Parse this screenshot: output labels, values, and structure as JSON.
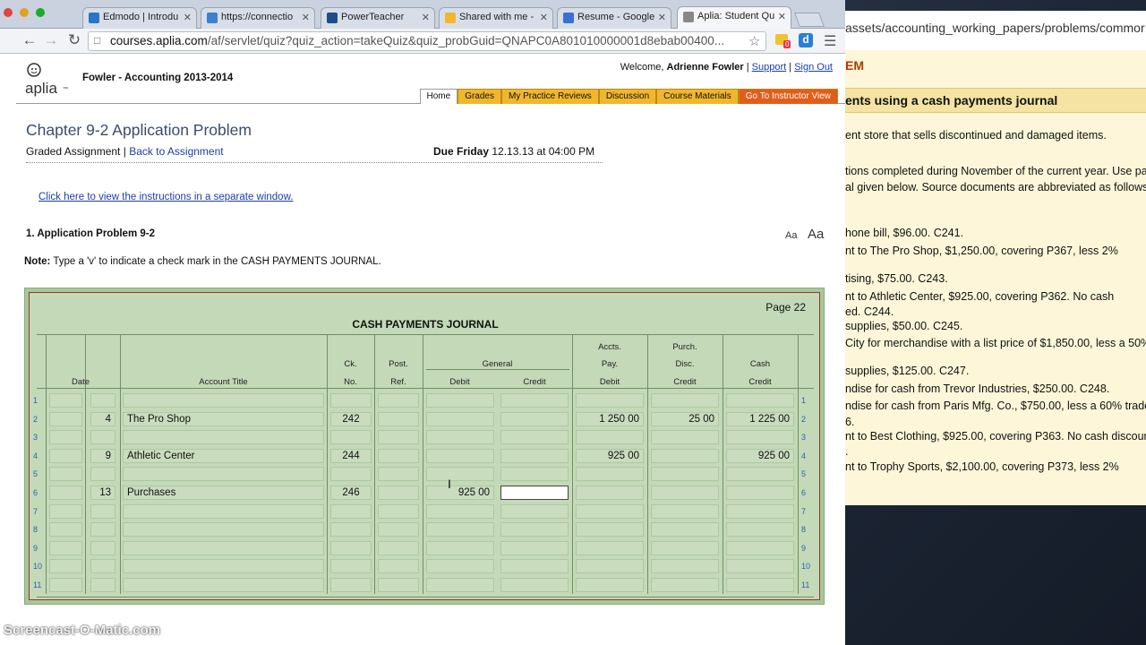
{
  "browser": {
    "tabs": [
      {
        "label": "Edmodo | Introdu",
        "icon_color": "#2b74c6"
      },
      {
        "label": "https://connectio",
        "icon_color": "#3f7fcf"
      },
      {
        "label": "PowerTeacher",
        "icon_color": "#1e4d8c"
      },
      {
        "label": "Shared with me -",
        "icon_color": "#f1b72c"
      },
      {
        "label": "Resume - Google",
        "icon_color": "#3b6fd6"
      },
      {
        "label": "Aplia: Student Qu",
        "icon_color": "#888888"
      }
    ],
    "url_host": "courses.aplia.com",
    "url_path": "/af/servlet/quiz?quiz_action=takeQuiz&quiz_probGuid=QNAPC0A801010000001d8ebab00400...",
    "ext_badge": "0"
  },
  "bg_window": {
    "url": "assets/accounting_working_papers/problems/commor",
    "heading_suffix": "EM",
    "subheading": "ents using a cash payments journal",
    "lines": [
      "ent store that sells discontinued and damaged items.",
      "tions completed during November of the current year. Use page",
      "al given below. Source documents are abbreviated as follows:",
      "hone bill, $96.00. C241.",
      "nt to The Pro Shop, $1,250.00, covering P367, less 2%",
      "tising, $75.00. C243.",
      "nt to Athletic Center, $925.00, covering P362. No cash",
      "ed. C244.",
      "supplies, $50.00. C245.",
      "City for merchandise with a list price of $1,850.00, less a 50%",
      "supplies, $125.00. C247.",
      "ndise for cash from Trevor Industries, $250.00. C248.",
      "ndise for cash from Paris Mfg. Co., $750.00, less a 60% trade",
      "6.",
      "nt to Best Clothing, $925.00, covering P363. No cash discount",
      ".",
      "nt to Trophy Sports, $2,100.00, covering P373, less 2%"
    ]
  },
  "aplia": {
    "logo_text": "aplia",
    "logo_tm": "™",
    "course": "Fowler - Accounting 2013-2014",
    "welcome_prefix": "Welcome,",
    "user_name": "Adrienne Fowler",
    "support": "Support",
    "sign_out": "Sign Out",
    "separator": "|",
    "nav": [
      "Home",
      "Grades",
      "My Practice Reviews",
      "Discussion",
      "Course Materials",
      "Go To Instructor View"
    ]
  },
  "page": {
    "title": "Chapter 9-2 Application Problem",
    "graded": "Graded Assignment",
    "sep": "|",
    "back": "Back to Assignment",
    "due_label": "Due Friday",
    "due_value": "12.13.13 at 04:00 PM",
    "instructions_link": "Click here to view the instructions in a separate window.",
    "problem": "1.  Application Problem 9-2",
    "font_small": "Aa",
    "font_large": "Aa",
    "note_label": "Note:",
    "note_text": " Type a 'v' to indicate a check mark in the CASH PAYMENTS JOURNAL."
  },
  "journal": {
    "page_label": "Page 22",
    "title": "CASH PAYMENTS JOURNAL",
    "headers": {
      "date": "Date",
      "account": "Account Title",
      "ck1": "Ck.",
      "ck2": "No.",
      "post1": "Post.",
      "post2": "Ref.",
      "general": "General",
      "gdebit": "Debit",
      "gcredit": "Credit",
      "ap1": "Accts.",
      "ap2": "Pay.",
      "ap3": "Debit",
      "pd1": "Purch.",
      "pd2": "Disc.",
      "pd3": "Credit",
      "cash1": "Cash",
      "cash2": "Credit"
    },
    "rows": [
      {
        "n": "1",
        "month": "",
        "day": "",
        "account": "",
        "ck": "",
        "post": "",
        "gdebit": "",
        "gcredit": "",
        "ap": "",
        "pd": "",
        "cash": ""
      },
      {
        "n": "2",
        "month": "",
        "day": "4",
        "account": "The Pro Shop",
        "ck": "242",
        "post": "",
        "gdebit": "",
        "gcredit": "",
        "ap": "1 250 00",
        "pd": "25 00",
        "cash": "1 225 00"
      },
      {
        "n": "3",
        "month": "",
        "day": "",
        "account": "",
        "ck": "",
        "post": "",
        "gdebit": "",
        "gcredit": "",
        "ap": "",
        "pd": "",
        "cash": ""
      },
      {
        "n": "4",
        "month": "",
        "day": "9",
        "account": "Athletic Center",
        "ck": "244",
        "post": "",
        "gdebit": "",
        "gcredit": "",
        "ap": "925 00",
        "pd": "",
        "cash": "925 00"
      },
      {
        "n": "5",
        "month": "",
        "day": "",
        "account": "",
        "ck": "",
        "post": "",
        "gdebit": "",
        "gcredit": "",
        "ap": "",
        "pd": "",
        "cash": ""
      },
      {
        "n": "6",
        "month": "",
        "day": "13",
        "account": "Purchases",
        "ck": "246",
        "post": "",
        "gdebit": "925 00",
        "gcredit": "",
        "ap": "",
        "pd": "",
        "cash": ""
      },
      {
        "n": "7",
        "month": "",
        "day": "",
        "account": "",
        "ck": "",
        "post": "",
        "gdebit": "",
        "gcredit": "",
        "ap": "",
        "pd": "",
        "cash": ""
      },
      {
        "n": "8",
        "month": "",
        "day": "",
        "account": "",
        "ck": "",
        "post": "",
        "gdebit": "",
        "gcredit": "",
        "ap": "",
        "pd": "",
        "cash": ""
      },
      {
        "n": "9",
        "month": "",
        "day": "",
        "account": "",
        "ck": "",
        "post": "",
        "gdebit": "",
        "gcredit": "",
        "ap": "",
        "pd": "",
        "cash": ""
      },
      {
        "n": "10",
        "month": "",
        "day": "",
        "account": "",
        "ck": "",
        "post": "",
        "gdebit": "",
        "gcredit": "",
        "ap": "",
        "pd": "",
        "cash": ""
      },
      {
        "n": "11",
        "month": "",
        "day": "",
        "account": "",
        "ck": "",
        "post": "",
        "gdebit": "",
        "gcredit": "",
        "ap": "",
        "pd": "",
        "cash": ""
      }
    ]
  },
  "watermark": "Screencast-O-Matic.com"
}
